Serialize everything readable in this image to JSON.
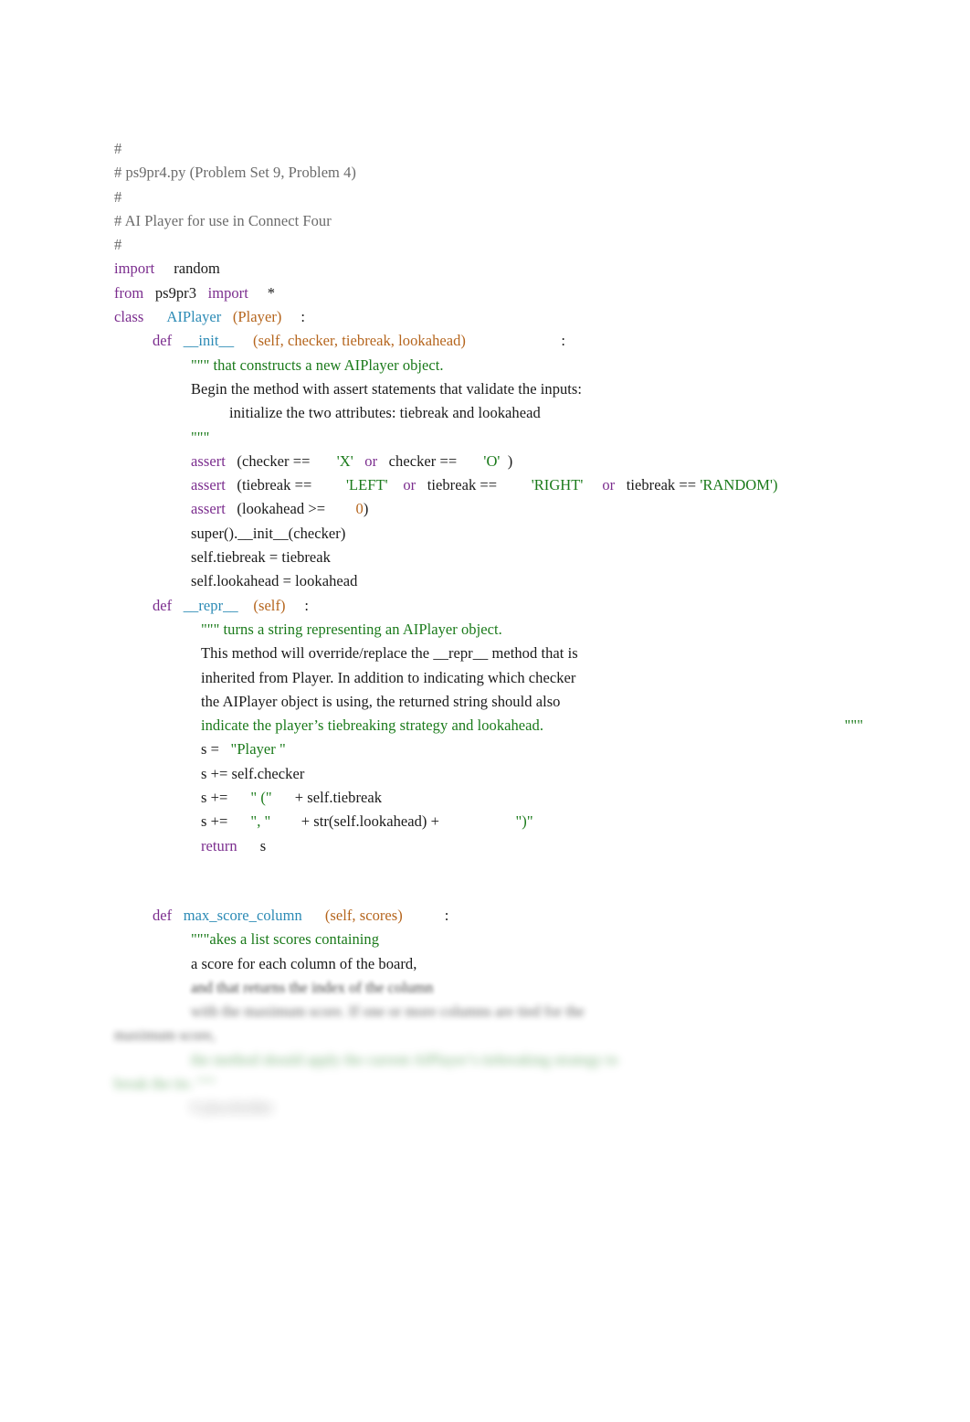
{
  "document": {
    "filename": "ps9pr4.py",
    "language": "python"
  },
  "colors": {
    "keyword": "#7b2d8e",
    "name": "#2b8ab5",
    "param": "#b5651d",
    "number": "#b5651d",
    "string": "#1a7a1a",
    "docstring": "#1a7a1a",
    "comment": "#6b6b6b",
    "plain": "#1a1a1a",
    "background": "#ffffff"
  },
  "code": {
    "header_comments": [
      "#",
      "# ps9pr4.py (Problem Set 9, Problem 4)",
      "#",
      "# AI Player for use in Connect Four",
      "#"
    ],
    "imports": {
      "import_kw": "import",
      "import_module": "random",
      "from_kw": "from",
      "from_module": "ps9pr3",
      "from_import_kw": "import",
      "star": "*"
    },
    "class_def": {
      "kw": "class",
      "name": "AIPlayer",
      "bases": "(Player)",
      "colon": ":"
    },
    "init_method": {
      "def_kw": "def",
      "name": "__init__",
      "params": "(self, checker, tiebreak, lookahead)",
      "colon": ":",
      "doc_open": "\"\"\"",
      "doc_line1": " that constructs a new AIPlayer object.",
      "doc_line2": "Begin the method with assert statements that validate the inputs:",
      "doc_line3": "initialize the two attributes: tiebreak and lookahead",
      "doc_close": "\"\"\"",
      "assert1": {
        "kw": "assert",
        "pre": "(checker ==",
        "str1": "'X'",
        "or": "or",
        "mid": "checker ==",
        "str2": "'O'",
        "close": ")"
      },
      "assert2": {
        "kw": "assert",
        "pre": "(tiebreak ==",
        "str1": "'LEFT'",
        "or1": "or",
        "mid1": "tiebreak ==",
        "str2": "'RIGHT'",
        "or2": "or",
        "mid2": "tiebreak ==",
        "str3": "'RANDOM')"
      },
      "assert3": {
        "kw": "assert",
        "pre": "(lookahead >=",
        "num": "0",
        "close": ")"
      },
      "super_call": "super().__init__(checker)",
      "attr1": "self.tiebreak = tiebreak",
      "attr2": "self.lookahead = lookahead"
    },
    "repr_method": {
      "def_kw": "def",
      "name": "__repr__",
      "params": "(self)",
      "colon": ":",
      "doc_open": "\"\"\"",
      "doc_line1": " turns a string representing an AIPlayer object.",
      "doc_line2": "This method will override/replace the __repr__ method that is",
      "doc_line3": "inherited from Player. In addition to indicating which checker",
      "doc_line4": "the AIPlayer object is using, the returned string should also",
      "doc_line5": "indicate the player’s tiebreaking strategy and lookahead.",
      "doc_close": "\"\"\"",
      "s_assign_pre": "s =",
      "s_assign_str": "\"Player \"",
      "s_plus_checker": "s += self.checker",
      "s_plus2_pre": "s +=",
      "s_plus2_str": "\" (\"",
      "s_plus2_post": "+ self.tiebreak",
      "s_plus3_pre": "s +=",
      "s_plus3_str": "\", \"",
      "s_plus3_mid": "+ str(self.lookahead) +",
      "s_plus3_str2": "\")\"",
      "return_kw": "return",
      "return_val": "s"
    },
    "max_score_column_method": {
      "def_kw": "def",
      "name": "max_score_column",
      "params": "(self, scores)",
      "colon": ":",
      "doc_open": "\"\"\"",
      "doc_line1": "akes a list scores containing",
      "doc_line2": "a score for each column of the board,",
      "doc_line3_blurred": "and that returns the index of the column",
      "doc_line4_blurred": "with the maximum score. If one or more columns are tied for the",
      "doc_line5_blurred": "maximum score,",
      "doc_line6_blurred": "the method should apply the current AIPlayer’s tiebreaking strategy to",
      "doc_line7_blurred": "break the tie. \"\"\"",
      "body_line_blurred": "# placeholder"
    }
  }
}
